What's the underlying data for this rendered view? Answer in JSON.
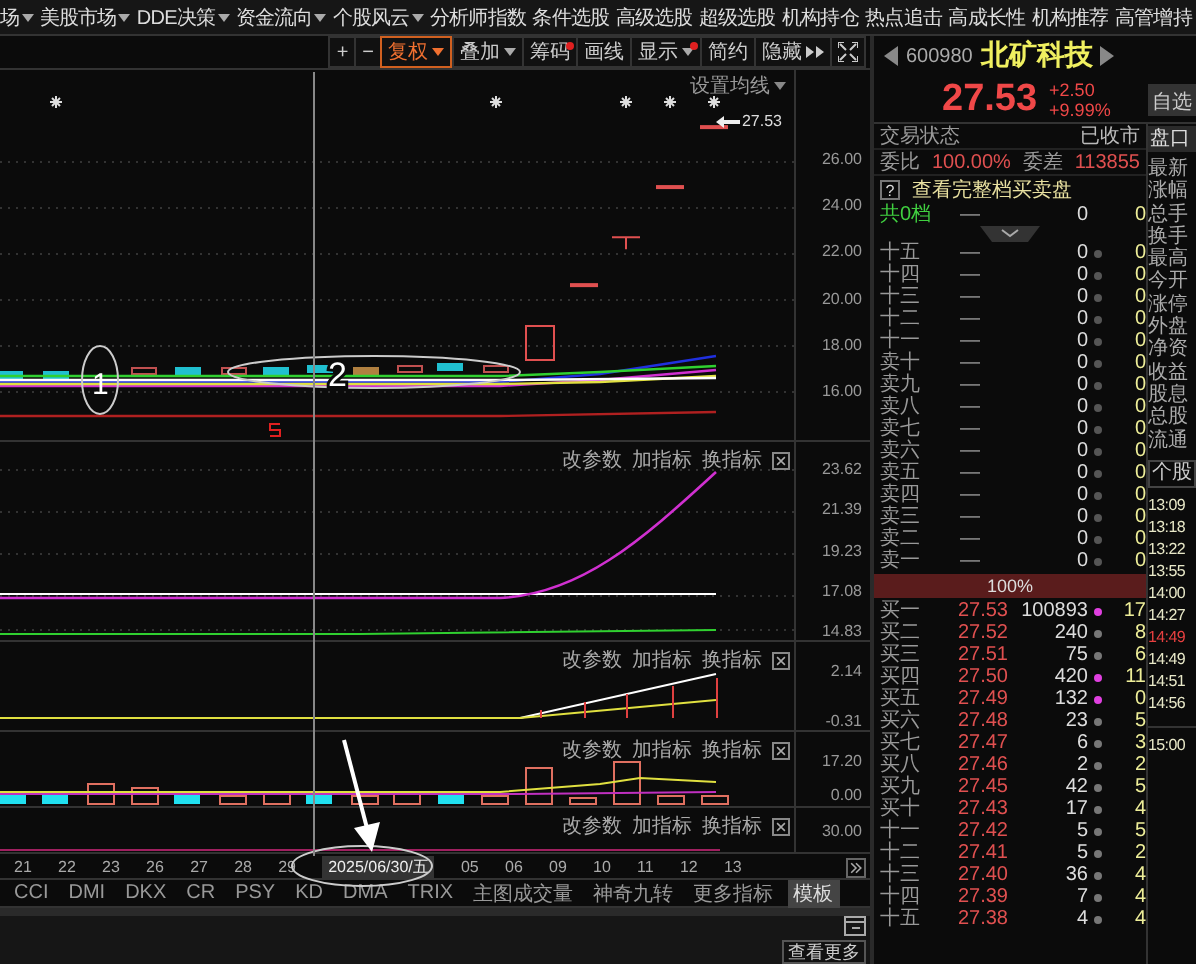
{
  "menu": [
    {
      "label": "场",
      "dropdown": true
    },
    {
      "label": "美股市场",
      "dropdown": true
    },
    {
      "label": "DDE决策",
      "dropdown": true
    },
    {
      "label": "资金流向",
      "dropdown": true
    },
    {
      "label": "个股风云",
      "dropdown": true
    },
    {
      "label": "分析师指数",
      "dropdown": false
    },
    {
      "label": "条件选股",
      "dropdown": false
    },
    {
      "label": "高级选股",
      "dropdown": false
    },
    {
      "label": "超级选股",
      "dropdown": false
    },
    {
      "label": "机构持仓",
      "dropdown": false
    },
    {
      "label": "热点追击",
      "dropdown": false
    },
    {
      "label": "高成长性",
      "dropdown": false
    },
    {
      "label": "机构推荐",
      "dropdown": false
    },
    {
      "label": "高管增持",
      "dropdown": false
    }
  ],
  "toolbar": [
    {
      "kind": "text",
      "label": "+",
      "selected": false,
      "dropdown": false,
      "dot": false
    },
    {
      "kind": "text",
      "label": "−",
      "selected": false,
      "dropdown": false,
      "dot": false
    },
    {
      "kind": "text",
      "label": "复权",
      "selected": true,
      "dropdown": true,
      "dot": false
    },
    {
      "kind": "text",
      "label": "叠加",
      "selected": false,
      "dropdown": true,
      "dot": false
    },
    {
      "kind": "text",
      "label": "筹码",
      "selected": false,
      "dropdown": false,
      "dot": true
    },
    {
      "kind": "text",
      "label": "画线",
      "selected": false,
      "dropdown": false,
      "dot": false
    },
    {
      "kind": "text",
      "label": "显示",
      "selected": false,
      "dropdown": true,
      "dot": true
    },
    {
      "kind": "text",
      "label": "简约",
      "selected": false,
      "dropdown": false,
      "dot": false
    },
    {
      "kind": "more",
      "label": "隐藏",
      "selected": false,
      "dropdown": false,
      "dot": false
    },
    {
      "kind": "fullscreen",
      "selected": false,
      "dropdown": false,
      "dot": false
    }
  ],
  "main_chart": {
    "ma_settings": "设置均线",
    "price_marker": "27.53",
    "axis_labels": [
      "26.00",
      "24.00",
      "22.00",
      "20.00",
      "18.00",
      "16.00"
    ],
    "annotations": [
      "1",
      "2"
    ]
  },
  "panels": [
    {
      "buttons": [
        "改参数",
        "加指标",
        "换指标"
      ],
      "axis_labels": [
        "23.62",
        "21.39",
        "19.23",
        "17.08",
        "14.83"
      ]
    },
    {
      "buttons": [
        "改参数",
        "加指标",
        "换指标"
      ],
      "axis_labels": [
        "2.14",
        "-0.31"
      ]
    },
    {
      "buttons": [
        "改参数",
        "加指标",
        "换指标"
      ],
      "axis_labels": [
        "17.20",
        "0.00"
      ]
    },
    {
      "buttons": [
        "改参数",
        "加指标",
        "换指标"
      ],
      "axis_labels": [
        "30.00"
      ]
    }
  ],
  "date_axis": {
    "before": [
      "21",
      "22",
      "23",
      "26",
      "27",
      "28",
      "29"
    ],
    "cursor_date": "2025/06/30/五",
    "after": [
      "05",
      "06",
      "09",
      "10",
      "11",
      "12",
      "13"
    ]
  },
  "indicator_tabs": [
    {
      "label": "CCI",
      "selected": false
    },
    {
      "label": "DMI",
      "selected": false
    },
    {
      "label": "DKX",
      "selected": false
    },
    {
      "label": "CR",
      "selected": false
    },
    {
      "label": "PSY",
      "selected": false
    },
    {
      "label": "KD",
      "selected": false
    },
    {
      "label": "DMA",
      "selected": false
    },
    {
      "label": "TRIX",
      "selected": false
    },
    {
      "label": "主图成交量",
      "selected": false
    },
    {
      "label": "神奇九转",
      "selected": false
    },
    {
      "label": "更多指标",
      "selected": false
    },
    {
      "label": "模板",
      "selected": true
    }
  ],
  "more_button": "查看更多",
  "quote": {
    "code": "600980",
    "name": "北矿科技",
    "price": "27.53",
    "change": "+2.50",
    "change_pct": "+9.99%",
    "watch_button": "自选"
  },
  "order_book": {
    "status_label": "交易状态",
    "status": "已收市",
    "ratio_label": "委比",
    "ratio": "100.00%",
    "diff_label": "委差",
    "diff": "113855",
    "help": "?",
    "full_link": "查看完整档买卖盘",
    "total": {
      "label": "共0档",
      "price": "—",
      "volume": "0",
      "count": "0"
    },
    "asks": [
      {
        "label": "十五",
        "price": "—",
        "volume": "0",
        "count": "0"
      },
      {
        "label": "十四",
        "price": "—",
        "volume": "0",
        "count": "0"
      },
      {
        "label": "十三",
        "price": "—",
        "volume": "0",
        "count": "0"
      },
      {
        "label": "十二",
        "price": "—",
        "volume": "0",
        "count": "0"
      },
      {
        "label": "十一",
        "price": "—",
        "volume": "0",
        "count": "0"
      },
      {
        "label": "卖十",
        "price": "—",
        "volume": "0",
        "count": "0"
      },
      {
        "label": "卖九",
        "price": "—",
        "volume": "0",
        "count": "0"
      },
      {
        "label": "卖八",
        "price": "—",
        "volume": "0",
        "count": "0"
      },
      {
        "label": "卖七",
        "price": "—",
        "volume": "0",
        "count": "0"
      },
      {
        "label": "卖六",
        "price": "—",
        "volume": "0",
        "count": "0"
      },
      {
        "label": "卖五",
        "price": "—",
        "volume": "0",
        "count": "0"
      },
      {
        "label": "卖四",
        "price": "—",
        "volume": "0",
        "count": "0"
      },
      {
        "label": "卖三",
        "price": "—",
        "volume": "0",
        "count": "0"
      },
      {
        "label": "卖二",
        "price": "—",
        "volume": "0",
        "count": "0"
      },
      {
        "label": "卖一",
        "price": "—",
        "volume": "0",
        "count": "0"
      }
    ],
    "bar": "100%",
    "bids": [
      {
        "label": "买一",
        "price": "27.53",
        "volume": "100893",
        "count": "17",
        "color": "#e040e0"
      },
      {
        "label": "买二",
        "price": "27.52",
        "volume": "240",
        "count": "8",
        "color": "#777777"
      },
      {
        "label": "买三",
        "price": "27.51",
        "volume": "75",
        "count": "6",
        "color": "#777777"
      },
      {
        "label": "买四",
        "price": "27.50",
        "volume": "420",
        "count": "11",
        "color": "#e040e0"
      },
      {
        "label": "买五",
        "price": "27.49",
        "volume": "132",
        "count": "0",
        "color": "#e040e0"
      },
      {
        "label": "买六",
        "price": "27.48",
        "volume": "23",
        "count": "5",
        "color": "#777777"
      },
      {
        "label": "买七",
        "price": "27.47",
        "volume": "6",
        "count": "3",
        "color": "#777777"
      },
      {
        "label": "买八",
        "price": "27.46",
        "volume": "2",
        "count": "2",
        "color": "#777777"
      },
      {
        "label": "买九",
        "price": "27.45",
        "volume": "42",
        "count": "5",
        "color": "#777777"
      },
      {
        "label": "买十",
        "price": "27.43",
        "volume": "17",
        "count": "4",
        "color": "#777777"
      },
      {
        "label": "十一",
        "price": "27.42",
        "volume": "5",
        "count": "5",
        "color": "#777777"
      },
      {
        "label": "十二",
        "price": "27.41",
        "volume": "5",
        "count": "2",
        "color": "#777777"
      },
      {
        "label": "十三",
        "price": "27.40",
        "volume": "36",
        "count": "4",
        "color": "#777777"
      },
      {
        "label": "十四",
        "price": "27.39",
        "volume": "7",
        "count": "4",
        "color": "#777777"
      },
      {
        "label": "十五",
        "price": "27.38",
        "volume": "4",
        "count": "4",
        "color": "#777777"
      }
    ]
  },
  "side": {
    "quote_tab": "盘口",
    "labels": [
      "最新",
      "涨幅",
      "总手",
      "换手",
      "最高",
      "今开",
      "涨停",
      "外盘",
      "净资",
      "收益",
      "股息",
      "总股",
      "流通"
    ],
    "ticks_tab": "个股",
    "times": [
      {
        "time": "13:09",
        "color": "#e8e8c8"
      },
      {
        "time": "13:18",
        "color": "#e8e8c8"
      },
      {
        "time": "13:22",
        "color": "#e8e8c8"
      },
      {
        "time": "13:55",
        "color": "#e8e8c8"
      },
      {
        "time": "14:00",
        "color": "#e8e8c8"
      },
      {
        "time": "14:27",
        "color": "#e8e8c8"
      },
      {
        "time": "14:49",
        "color": "#e84040"
      },
      {
        "time": "14:49",
        "color": "#e8e8c8"
      },
      {
        "time": "14:51",
        "color": "#e8e8c8"
      },
      {
        "time": "14:56",
        "color": "#e8e8c8"
      }
    ],
    "close_time": "15:00"
  }
}
